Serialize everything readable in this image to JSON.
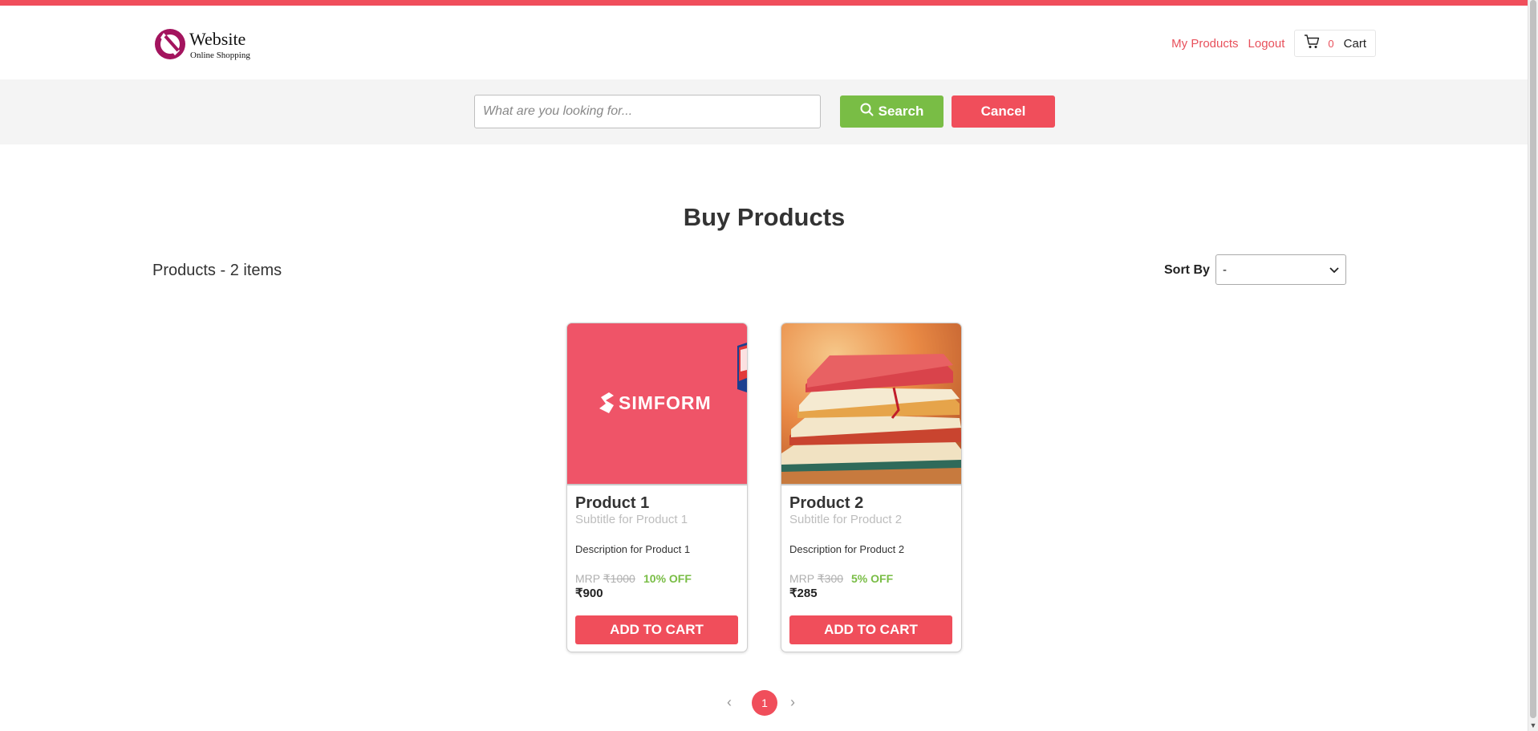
{
  "header": {
    "logo_name": "Website",
    "logo_tagline": "Online Shopping",
    "nav_my_products": "My Products",
    "nav_logout": "Logout",
    "cart_count": "0",
    "cart_label": "Cart"
  },
  "search": {
    "placeholder": "What are you looking for...",
    "value": "",
    "search_label": "Search",
    "cancel_label": "Cancel"
  },
  "main": {
    "title": "Buy Products",
    "count_label": "Products - 2 items",
    "sort_label": "Sort By",
    "sort_value": "-"
  },
  "products": [
    {
      "name": "Product 1",
      "subtitle": "Subtitle for Product 1",
      "description": "Description for Product 1",
      "mrp_prefix": "MRP",
      "mrp": "₹1000",
      "discount": "10% OFF",
      "price": "₹900",
      "button": "ADD TO CART",
      "image_text": "SIMFORM"
    },
    {
      "name": "Product 2",
      "subtitle": "Subtitle for Product 2",
      "description": "Description for Product 2",
      "mrp_prefix": "MRP",
      "mrp": "₹300",
      "discount": "5% OFF",
      "price": "₹285",
      "button": "ADD TO CART"
    }
  ],
  "pagination": {
    "current": "1",
    "prev_icon": "‹",
    "next_icon": "›"
  },
  "colors": {
    "accent": "#f04e5b",
    "search_green": "#79bd45",
    "band_gray": "#f4f4f4"
  },
  "icons": [
    "search-icon",
    "cart-icon",
    "chevron-down-icon",
    "chevron-left-icon",
    "chevron-right-icon"
  ]
}
